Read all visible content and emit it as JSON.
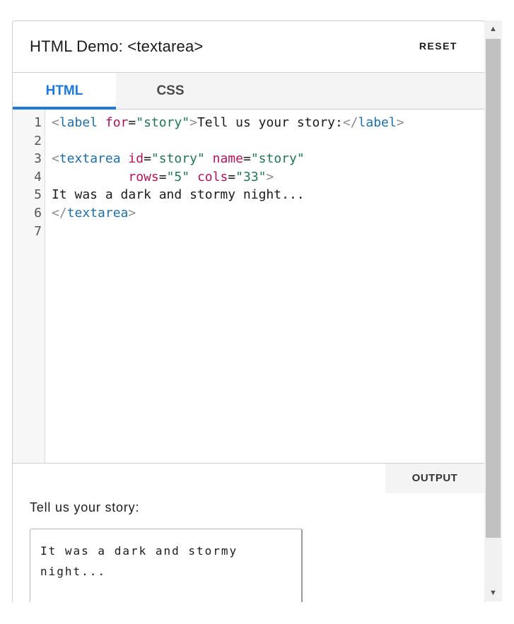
{
  "header": {
    "title": "HTML Demo: <textarea>",
    "reset_label": "RESET"
  },
  "tabs": [
    {
      "label": "HTML",
      "active": true
    },
    {
      "label": "CSS",
      "active": false
    }
  ],
  "editor": {
    "line_numbers": [
      "1",
      "2",
      "3",
      "4",
      "5",
      "6",
      "7"
    ],
    "lines": [
      [
        {
          "t": "<",
          "c": "bracket"
        },
        {
          "t": "label",
          "c": "tag"
        },
        {
          "t": " ",
          "c": "text"
        },
        {
          "t": "for",
          "c": "attr"
        },
        {
          "t": "=",
          "c": "eq"
        },
        {
          "t": "\"story\"",
          "c": "str"
        },
        {
          "t": ">",
          "c": "bracket"
        },
        {
          "t": "Tell us your story:",
          "c": "text"
        },
        {
          "t": "</",
          "c": "bracket"
        },
        {
          "t": "label",
          "c": "tag"
        },
        {
          "t": ">",
          "c": "bracket"
        }
      ],
      [],
      [
        {
          "t": "<",
          "c": "bracket"
        },
        {
          "t": "textarea",
          "c": "tag"
        },
        {
          "t": " ",
          "c": "text"
        },
        {
          "t": "id",
          "c": "attr"
        },
        {
          "t": "=",
          "c": "eq"
        },
        {
          "t": "\"story\"",
          "c": "str"
        },
        {
          "t": " ",
          "c": "text"
        },
        {
          "t": "name",
          "c": "attr"
        },
        {
          "t": "=",
          "c": "eq"
        },
        {
          "t": "\"story\"",
          "c": "str"
        }
      ],
      [
        {
          "t": "          ",
          "c": "text"
        },
        {
          "t": "rows",
          "c": "attr"
        },
        {
          "t": "=",
          "c": "eq"
        },
        {
          "t": "\"5\"",
          "c": "str"
        },
        {
          "t": " ",
          "c": "text"
        },
        {
          "t": "cols",
          "c": "attr"
        },
        {
          "t": "=",
          "c": "eq"
        },
        {
          "t": "\"33\"",
          "c": "str"
        },
        {
          "t": ">",
          "c": "bracket"
        }
      ],
      [
        {
          "t": "It was a dark and stormy night...",
          "c": "text"
        }
      ],
      [
        {
          "t": "</",
          "c": "bracket"
        },
        {
          "t": "textarea",
          "c": "tag"
        },
        {
          "t": ">",
          "c": "bracket"
        }
      ],
      []
    ]
  },
  "output": {
    "tab_label": "OUTPUT",
    "label": "Tell us your story:",
    "textarea_value": "It was a dark and stormy night..."
  },
  "colors": {
    "accent": "#1e79db",
    "tag": "#1f6ea8",
    "attr": "#b0135a",
    "string": "#227654"
  },
  "icons": {
    "scroll_up": "triangle-up-icon",
    "scroll_down": "triangle-down-icon"
  }
}
